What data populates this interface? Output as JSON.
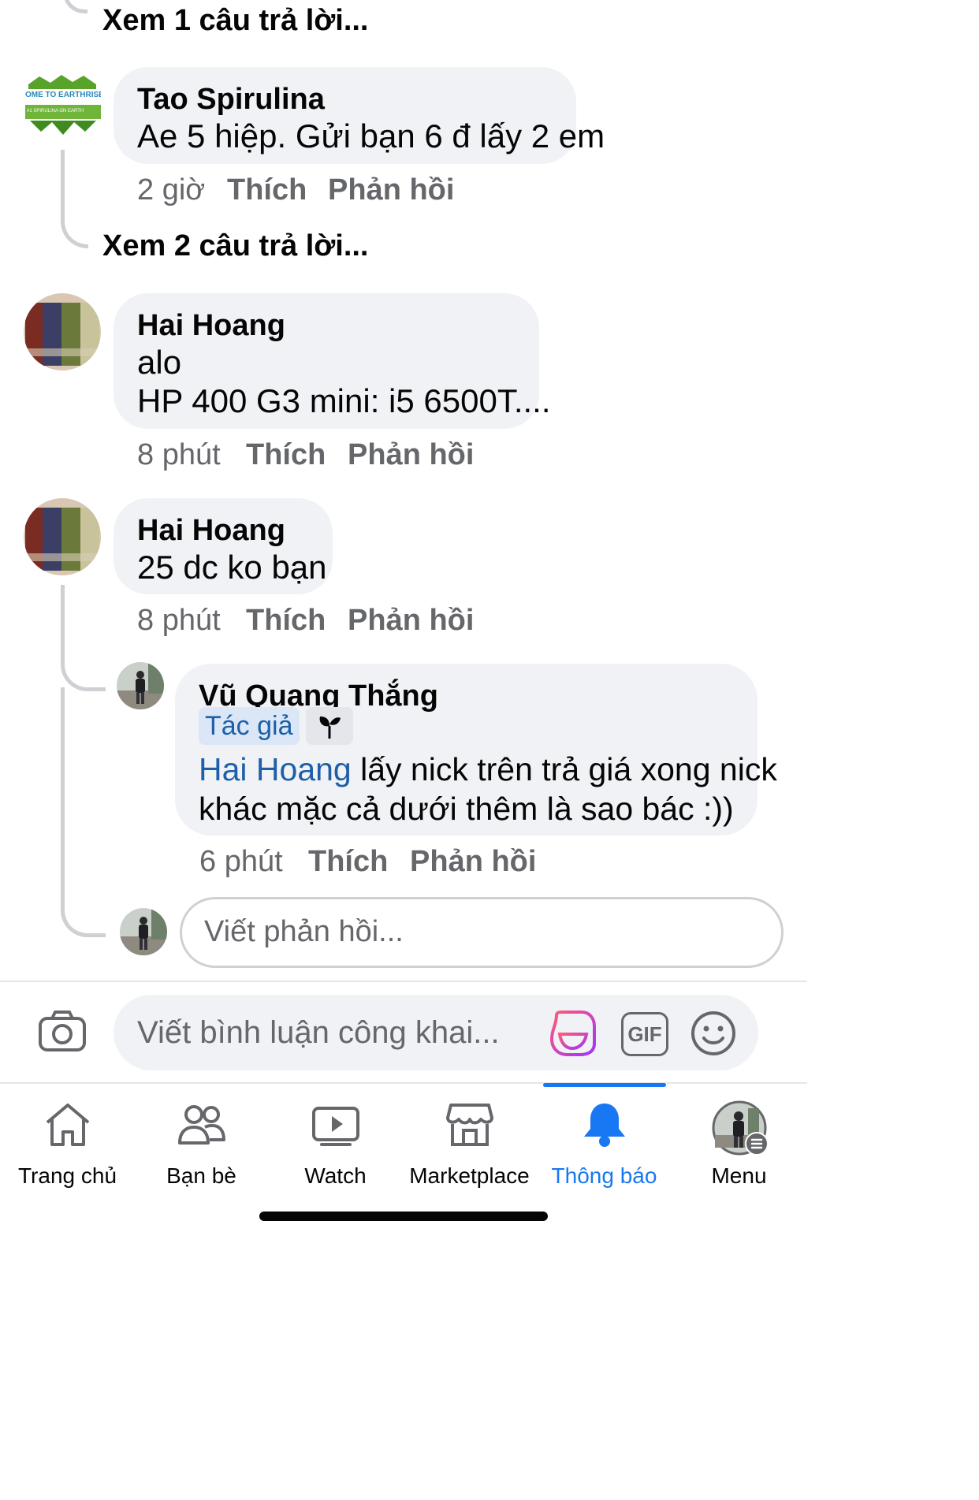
{
  "comments": [
    {
      "view_replies": "Xem 1 câu trả lời..."
    },
    {
      "author": "Tao Spirulina",
      "lines": [
        "Ae 5 hiệp. Gửi bạn 6 đ lấy 2 em"
      ],
      "time": "2 giờ",
      "like": "Thích",
      "reply": "Phản hồi",
      "avatar_text_1": "OME TO EARTHRISE",
      "avatar_text_2": "#1 SPIRULINA ON EARTH",
      "view_replies": "Xem 2 câu trả lời..."
    },
    {
      "author": "Hai Hoang",
      "lines": [
        "alo",
        "HP 400 G3 mini: i5 6500T...."
      ],
      "time": "8 phút",
      "like": "Thích",
      "reply": "Phản hồi"
    },
    {
      "author": "Hai Hoang",
      "lines": [
        "25 dc ko bạn"
      ],
      "time": "8 phút",
      "like": "Thích",
      "reply": "Phản hồi",
      "reply_item": {
        "author": "Vũ Quang Thắng",
        "badge": "Tác giả",
        "badge_icon": "sprout-icon",
        "mention": "Hai Hoang",
        "text_line1": " lấy nick trên trả giá xong nick",
        "text_line2": "khác mặc cả dưới thêm là sao bác :))",
        "time": "6 phút",
        "like": "Thích",
        "reply": "Phản hồi"
      },
      "reply_placeholder": "Viết phản hồi..."
    }
  ],
  "composer": {
    "placeholder": "Viết bình luận công khai...",
    "icons": [
      "camera-icon",
      "avatar-sticker-icon",
      "gif-icon",
      "emoji-icon"
    ],
    "gif_label": "GIF"
  },
  "tabbar": {
    "items": [
      {
        "label": "Trang chủ",
        "icon": "home-icon"
      },
      {
        "label": "Bạn bè",
        "icon": "friends-icon"
      },
      {
        "label": "Watch",
        "icon": "watch-icon"
      },
      {
        "label": "Marketplace",
        "icon": "marketplace-icon"
      },
      {
        "label": "Thông báo",
        "icon": "bell-icon",
        "active": true
      },
      {
        "label": "Menu",
        "icon": "menu-avatar-icon"
      }
    ]
  },
  "colors": {
    "accent": "#1877f2",
    "bubble": "#f0f2f5",
    "muted": "#65676b",
    "thread": "#ced0d4"
  }
}
